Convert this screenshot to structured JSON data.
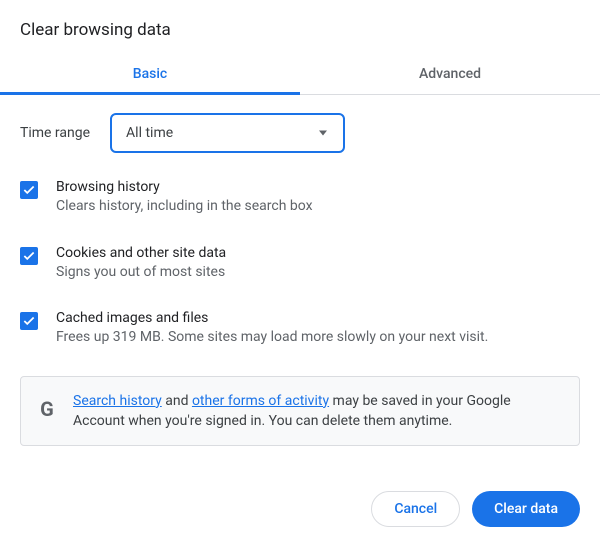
{
  "title": "Clear browsing data",
  "tabs": {
    "basic": "Basic",
    "advanced": "Advanced",
    "active": "basic"
  },
  "time_range": {
    "label": "Time range",
    "selected": "All time"
  },
  "options": [
    {
      "checked": true,
      "title": "Browsing history",
      "desc": "Clears history, including in the search box"
    },
    {
      "checked": true,
      "title": "Cookies and other site data",
      "desc": "Signs you out of most sites"
    },
    {
      "checked": true,
      "title": "Cached images and files",
      "desc": "Frees up 319 MB. Some sites may load more slowly on your next visit."
    }
  ],
  "info": {
    "icon": "G",
    "link1": "Search history",
    "mid1": " and ",
    "link2": "other forms of activity",
    "rest": " may be saved in your Google Account when you're signed in. You can delete them anytime."
  },
  "buttons": {
    "cancel": "Cancel",
    "confirm": "Clear data"
  }
}
